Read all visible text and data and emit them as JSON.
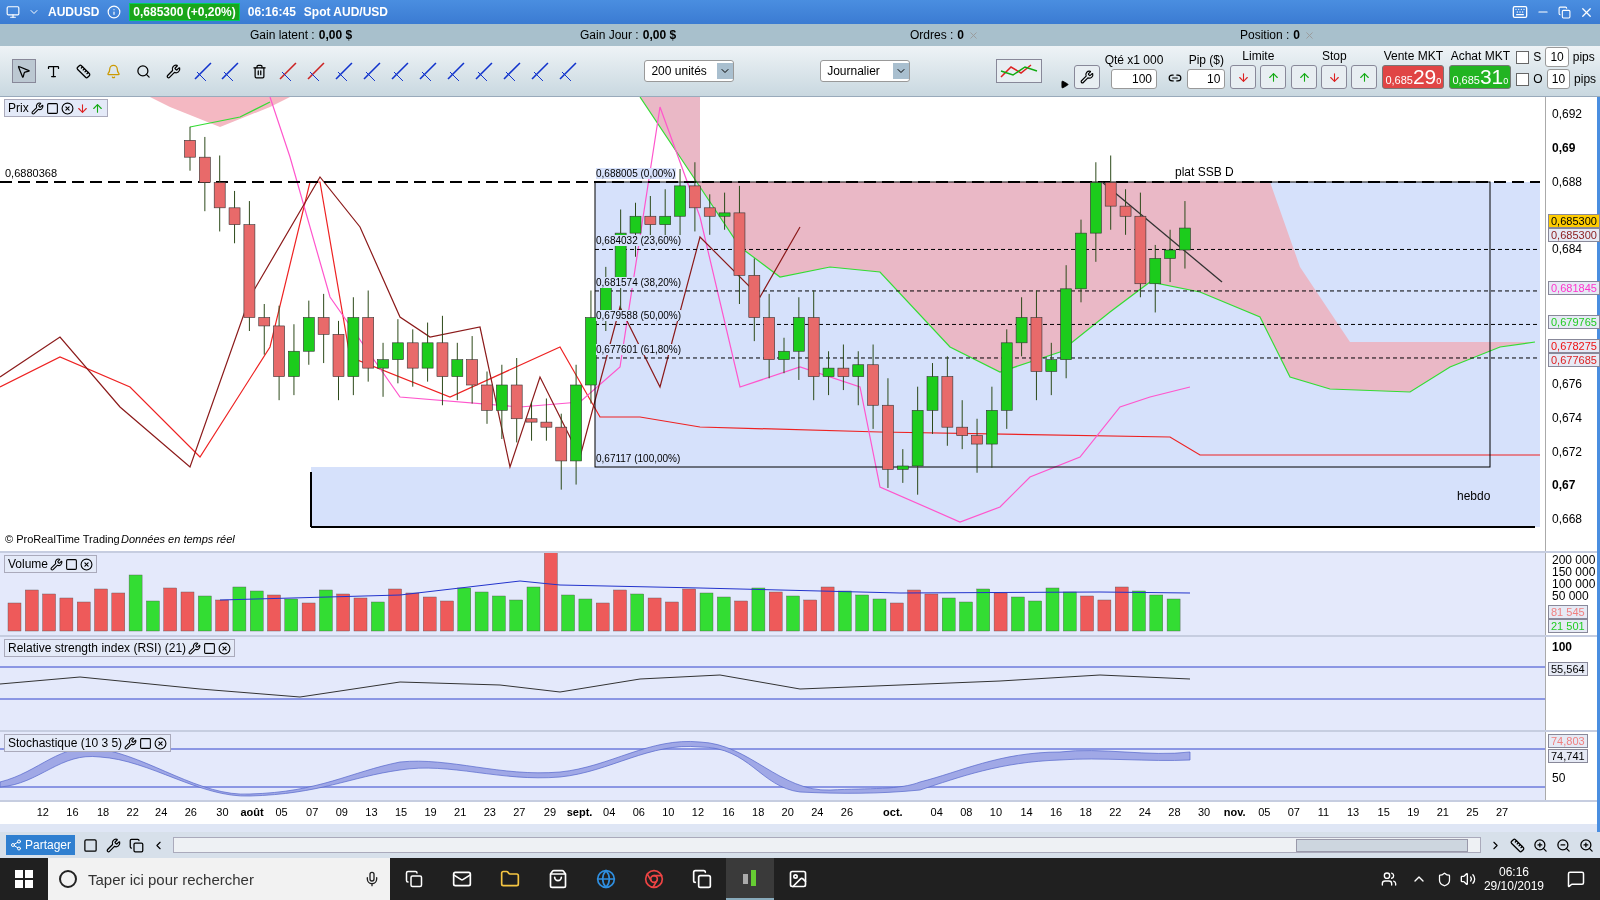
{
  "title_bar": {
    "symbol": "AUDUSD",
    "price_badge": "0,685300 (+0,20%)",
    "time": "06:16:45",
    "description": "Spot AUD/USD"
  },
  "account_bar": [
    {
      "label": "Gain latent :",
      "value": "0,00 $"
    },
    {
      "label": "Gain Jour :",
      "value": "0,00 $"
    },
    {
      "label": "Ordres :",
      "value": "0"
    },
    {
      "label": "Position :",
      "value": "0"
    }
  ],
  "toolbar": {
    "units_select": "200 unités",
    "period_select": "Journalier"
  },
  "order_panel": {
    "qty_label": "Qté x1 000",
    "qty": "100",
    "pip_label": "Pip ($)",
    "pip": "10",
    "limit_label": "Limite",
    "stop_label": "Stop",
    "sell": {
      "label": "Vente MKT",
      "prefix": "0,685",
      "main": "29",
      "sup": "0"
    },
    "buy": {
      "label": "Achat MKT",
      "prefix": "0,685",
      "main": "31",
      "sup": "0"
    },
    "options": [
      {
        "label": "S",
        "checked": false,
        "value": "10",
        "unit": "pips"
      },
      {
        "label": "O",
        "checked": false,
        "value": "10",
        "unit": "pips"
      }
    ]
  },
  "price_pane": {
    "title": "Prix",
    "left_level": "0,6880368",
    "fib_labels": [
      "0,688005 (0,00%)",
      "0,684032 (23,60%)",
      "0,681574 (38,20%)",
      "0,679588 (50,00%)",
      "0,677601 (61,80%)",
      "0,67117 (100,00%)"
    ],
    "note_top": "plat SSB D",
    "note_bottom": "hebdo",
    "copyright": "© ProRealTime Trading",
    "realtime": "Données en temps réel",
    "axis": [
      {
        "label": "0,692",
        "kind": "minor"
      },
      {
        "label": "0,69",
        "kind": "major"
      },
      {
        "label": "0,688",
        "kind": "minor"
      },
      {
        "label": "0,684",
        "kind": "minor"
      },
      {
        "label": "0,676",
        "kind": "minor"
      },
      {
        "label": "0,674",
        "kind": "minor"
      },
      {
        "label": "0,672",
        "kind": "minor"
      },
      {
        "label": "0,67",
        "kind": "major"
      },
      {
        "label": "0,668",
        "kind": "minor"
      }
    ],
    "tags": [
      {
        "label": "0,685300",
        "kind": "current",
        "color": "#ffcc00"
      },
      {
        "label": "0,685300",
        "kind": "line",
        "color": "#8b1a1a"
      },
      {
        "label": "0,681845",
        "kind": "line",
        "color": "#ff33cc"
      },
      {
        "label": "0,679765",
        "kind": "line",
        "color": "#22cc22"
      },
      {
        "label": "0,678275",
        "kind": "line",
        "color": "#ee1111"
      },
      {
        "label": "0,677685",
        "kind": "line",
        "color": "#dd2222"
      }
    ]
  },
  "volume_pane": {
    "title": "Volume",
    "axis": [
      "200 000",
      "150 000",
      "100 000",
      "50 000"
    ],
    "tags": [
      {
        "label": "81 545",
        "color": "#f08080"
      },
      {
        "label": "21 501",
        "color": "#22cc22"
      }
    ]
  },
  "rsi_pane": {
    "title": "Relative strength index (RSI) (21)",
    "axis": [
      "100"
    ],
    "tags": [
      {
        "label": "55,564",
        "color": "#000000"
      }
    ]
  },
  "stoch_pane": {
    "title": "Stochastique (10 3 5)",
    "axis": [
      "50"
    ],
    "tags": [
      {
        "label": "74,803",
        "color": "#f08080"
      },
      {
        "label": "74,741",
        "color": "#000000"
      }
    ]
  },
  "date_axis": [
    {
      "label": "12",
      "kind": "day"
    },
    {
      "label": "16",
      "kind": "day"
    },
    {
      "label": "18",
      "kind": "day"
    },
    {
      "label": "22",
      "kind": "day"
    },
    {
      "label": "24",
      "kind": "day"
    },
    {
      "label": "26",
      "kind": "day"
    },
    {
      "label": "30",
      "kind": "day"
    },
    {
      "label": "août",
      "kind": "month"
    },
    {
      "label": "05",
      "kind": "day"
    },
    {
      "label": "07",
      "kind": "day"
    },
    {
      "label": "09",
      "kind": "day"
    },
    {
      "label": "13",
      "kind": "day"
    },
    {
      "label": "15",
      "kind": "day"
    },
    {
      "label": "19",
      "kind": "day"
    },
    {
      "label": "21",
      "kind": "day"
    },
    {
      "label": "23",
      "kind": "day"
    },
    {
      "label": "27",
      "kind": "day"
    },
    {
      "label": "29",
      "kind": "day"
    },
    {
      "label": "sept.",
      "kind": "month"
    },
    {
      "label": "04",
      "kind": "day"
    },
    {
      "label": "06",
      "kind": "day"
    },
    {
      "label": "10",
      "kind": "day"
    },
    {
      "label": "12",
      "kind": "day"
    },
    {
      "label": "16",
      "kind": "day"
    },
    {
      "label": "18",
      "kind": "day"
    },
    {
      "label": "20",
      "kind": "day"
    },
    {
      "label": "24",
      "kind": "day"
    },
    {
      "label": "26",
      "kind": "day"
    },
    {
      "label": "oct.",
      "kind": "month"
    },
    {
      "label": "04",
      "kind": "day"
    },
    {
      "label": "08",
      "kind": "day"
    },
    {
      "label": "10",
      "kind": "day"
    },
    {
      "label": "14",
      "kind": "day"
    },
    {
      "label": "16",
      "kind": "day"
    },
    {
      "label": "18",
      "kind": "day"
    },
    {
      "label": "22",
      "kind": "day"
    },
    {
      "label": "24",
      "kind": "day"
    },
    {
      "label": "28",
      "kind": "day"
    },
    {
      "label": "30",
      "kind": "day"
    },
    {
      "label": "nov.",
      "kind": "month"
    },
    {
      "label": "05",
      "kind": "day"
    },
    {
      "label": "07",
      "kind": "day"
    },
    {
      "label": "11",
      "kind": "day"
    },
    {
      "label": "13",
      "kind": "day"
    },
    {
      "label": "15",
      "kind": "day"
    },
    {
      "label": "19",
      "kind": "day"
    },
    {
      "label": "21",
      "kind": "day"
    },
    {
      "label": "25",
      "kind": "day"
    },
    {
      "label": "27",
      "kind": "day"
    }
  ],
  "bottom_bar": {
    "share_button": "Partager"
  },
  "taskbar": {
    "search_placeholder": "Taper ici pour rechercher",
    "time": "06:16",
    "date": "29/10/2019"
  }
}
